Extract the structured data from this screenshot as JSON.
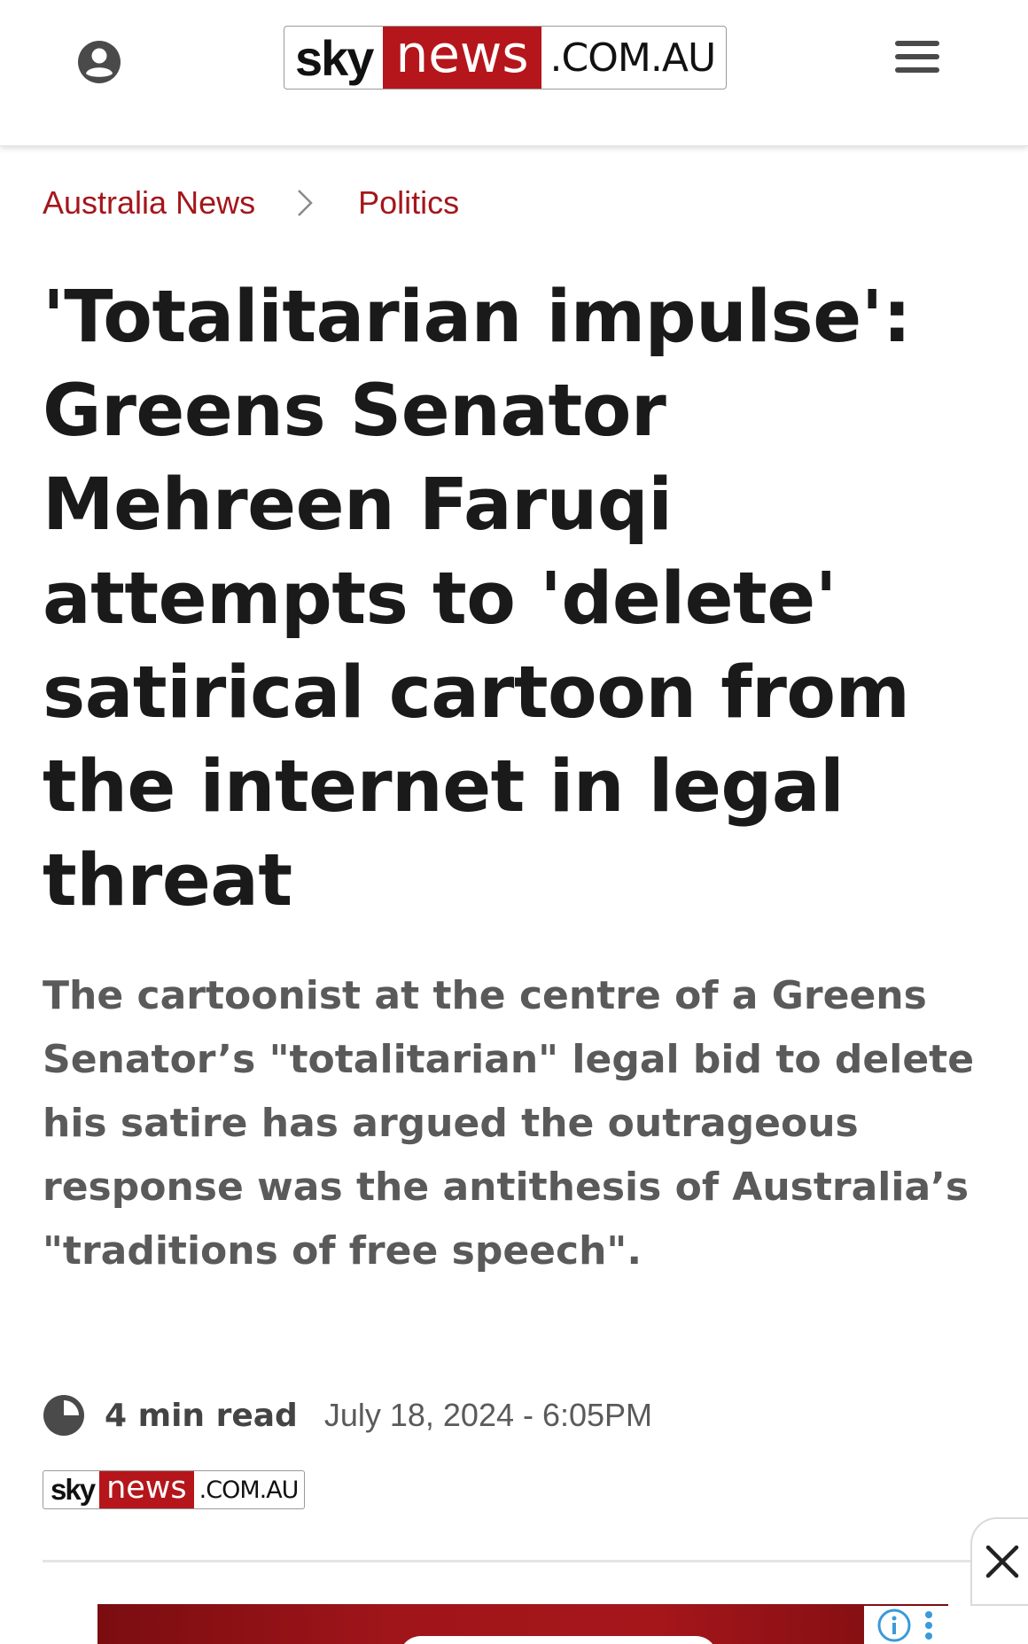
{
  "header": {
    "logo": {
      "sky": "sky",
      "news": "news",
      "domain": ".COM.AU"
    },
    "account_icon": "user-account-icon",
    "menu_icon": "hamburger-menu-icon"
  },
  "breadcrumb": {
    "items": [
      {
        "label": "Australia News"
      },
      {
        "label": "Politics"
      }
    ],
    "separator_icon": "chevron-right-icon"
  },
  "article": {
    "headline": "'Totalitarian impulse': Greens Senator Mehreen Faruqi attempts to 'delete' satirical cartoon from the internet in legal threat",
    "standfirst": "The cartoonist at the centre of a Greens Senator’s \"totalitarian\" legal bid to delete his satire has argued the outrageous response was the antithesis of Australia’s \"traditions of free speech\".",
    "read_time": "4 min read",
    "date": "July 18, 2024 - 6:05PM",
    "source_logo": {
      "sky": "sky",
      "news": "news",
      "domain": ".COM.AU"
    }
  },
  "ad": {
    "close_icon": "close-icon",
    "info_icon": "info-icon",
    "more_icon": "more-vertical-icon"
  },
  "colors": {
    "brand_red": "#b5161b",
    "breadcrumb_red": "#a4161b",
    "headline": "#1a1a1a",
    "standfirst": "#5a5a5a"
  }
}
